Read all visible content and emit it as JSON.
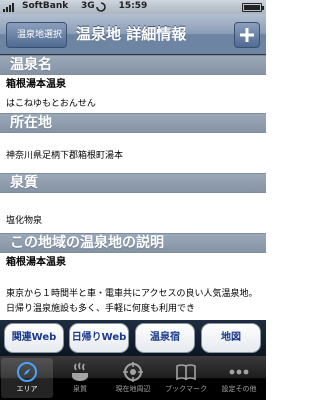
{
  "status_bar": {
    "carrier": "SoftBank",
    "network": "3G",
    "time": "15:59"
  },
  "nav_bar": {
    "back_label": "温泉地選択",
    "title": "温泉地 詳細情報",
    "add_label": "+"
  },
  "sections": {
    "name": {
      "header": "温泉名",
      "value": "箱根湯本温泉",
      "reading": "はこねゆもとおんせん"
    },
    "location": {
      "header": "所在地",
      "value": "神奈川県足柄下郡箱根町湯本"
    },
    "spring_quality": {
      "header": "泉質",
      "value": "塩化物泉"
    },
    "description": {
      "header": "この地域の温泉地の説明",
      "title": "箱根湯本温泉",
      "text": "東京から１時間半と車・電車共にアクセスの良い人気温泉地。日帰り温泉施設も多く、手軽に何度も利用でき"
    }
  },
  "link_buttons": [
    {
      "label": "関連Web"
    },
    {
      "label": "日帰りWeb"
    },
    {
      "label": "温泉宿"
    },
    {
      "label": "地図"
    }
  ],
  "tab_bar": {
    "items": [
      {
        "label": "エリア",
        "icon": "compass-icon",
        "active": true
      },
      {
        "label": "泉質",
        "icon": "hot-spring-icon",
        "active": false
      },
      {
        "label": "現在地周辺",
        "icon": "location-target-icon",
        "active": false
      },
      {
        "label": "ブックマーク",
        "icon": "book-icon",
        "active": false
      },
      {
        "label": "設定その他",
        "icon": "more-icon",
        "active": false
      }
    ]
  },
  "colors": {
    "nav_bar": "#6d84a2",
    "section_header": "#8f9db0",
    "link_text": "#1a3a8a",
    "tab_active": "#ffffff",
    "tab_inactive": "#a3a3a3"
  }
}
